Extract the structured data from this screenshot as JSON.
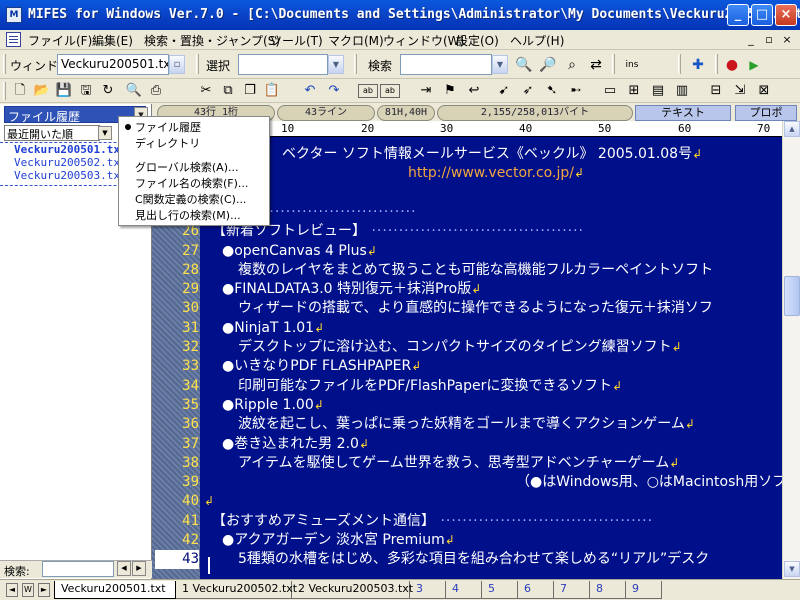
{
  "window": {
    "title": "MIFES for Windows Ver.7.0 - [C:\\Documents and Settings\\Administrator\\My Documents\\Veckuru200501.txt]",
    "icon_label": "M",
    "buttons": {
      "minimize": "_",
      "maximize": "□",
      "close": "×"
    }
  },
  "menu": {
    "items": [
      "ファイル(F)",
      "編集(E)",
      "検索・置換・ジャンプ(S)",
      "ツール(T)",
      "マクロ(M)",
      "ウィンドウ(W)",
      "設定(O)",
      "ヘルプ(H)"
    ],
    "mdi": [
      "_",
      "▫",
      "×"
    ]
  },
  "toolbar1": {
    "window_label": "ウィンドウ",
    "window_value": "Veckuru200501.txt",
    "select_label": "選択",
    "select_value": "",
    "search_label": "検索",
    "search_value": "",
    "icons": [
      "search-next-icon",
      "search-prev-icon",
      "search-all-icon",
      "replace-icon",
      "insert-icon",
      "add-icon",
      "record-icon",
      "play-icon"
    ]
  },
  "toolbar2": {
    "icons": [
      "new-file-icon",
      "open-icon",
      "save-icon",
      "save-all-icon",
      "refresh-icon",
      "preview-icon",
      "print-icon",
      "cut-icon",
      "copy-icon",
      "paste-icon",
      "undo-icon",
      "redo-icon",
      "abc-icon",
      "jump-icon",
      "tag-icon",
      "back-icon",
      "window1-icon",
      "window2-icon",
      "tile-icon",
      "cascade-icon",
      "split-icon",
      "exit-icon"
    ]
  },
  "status": {
    "line_col": "43行  1桁",
    "lines": "43ライン",
    "char_code": "81H,40H",
    "bytes": "2,155/258,013バイト",
    "mode_text": "テキスト",
    "mode_prop": "プロポ"
  },
  "ruler": {
    "marks": [
      "10",
      "20",
      "30",
      "40",
      "50",
      "60",
      "70"
    ]
  },
  "panel": {
    "combo": "ファイル履歴",
    "sort": "最近開いた順",
    "files": [
      "Veckuru200501.txt",
      "Veckuru200502.txt",
      "Veckuru200503.txt"
    ],
    "search_label": "検索:"
  },
  "popup": {
    "items": [
      "ファイル履歴",
      "ディレクトリ"
    ],
    "actions": [
      "グローバル検索(A)...",
      "ファイル名の検索(F)...",
      "C関数定義の検索(C)...",
      "見出し行の検索(M)..."
    ]
  },
  "editor": {
    "lines": [
      {
        "no": "",
        "text": "ベクター ソフト情報メールサービス《ベックル》 2005.01.08号",
        "eol": "↲",
        "kind": "header"
      },
      {
        "no": "",
        "text": "http://www.vector.co.jp/",
        "eol": "↲",
        "kind": "url"
      },
      {
        "no": "",
        "text": "",
        "eol": "",
        "kind": "blank"
      },
      {
        "no": "",
        "text": "",
        "eol": "",
        "kind": "rule"
      },
      {
        "no": "26",
        "text": "【新着ソフトレビュー】",
        "eol": "",
        "kind": "section"
      },
      {
        "no": "27",
        "text": "●openCanvas 4 Plus",
        "eol": "↲",
        "kind": "item"
      },
      {
        "no": "28",
        "text": "複数のレイヤをまとめて扱うことも可能な高機能フルカラーペイントソフト",
        "eol": "",
        "kind": "desc"
      },
      {
        "no": "29",
        "text": "●FINALDATA3.0 特別復元＋抹消Pro版",
        "eol": "↲",
        "kind": "item"
      },
      {
        "no": "30",
        "text": "ウィザードの搭載で、より直感的に操作できるようになった復元＋抹消ソフ",
        "eol": "",
        "kind": "desc"
      },
      {
        "no": "31",
        "text": "●NinjaT 1.01",
        "eol": "↲",
        "kind": "item"
      },
      {
        "no": "32",
        "text": "デスクトップに溶け込む、コンパクトサイズのタイピング練習ソフト",
        "eol": "↲",
        "kind": "desc"
      },
      {
        "no": "33",
        "text": "●いきなりPDF FLASHPAPER",
        "eol": "↲",
        "kind": "item"
      },
      {
        "no": "34",
        "text": "印刷可能なファイルをPDF/FlashPaperに変換できるソフト",
        "eol": "↲",
        "kind": "desc"
      },
      {
        "no": "35",
        "text": "●Ripple 1.00",
        "eol": "↲",
        "kind": "item"
      },
      {
        "no": "36",
        "text": "波紋を起こし、葉っぱに乗った妖精をゴールまで導くアクションゲーム",
        "eol": "↲",
        "kind": "desc"
      },
      {
        "no": "37",
        "text": "●巻き込まれた男 2.0",
        "eol": "↲",
        "kind": "item"
      },
      {
        "no": "38",
        "text": "アイテムを駆使してゲーム世界を救う、思考型アドベンチャーゲーム",
        "eol": "↲",
        "kind": "desc"
      },
      {
        "no": "39",
        "text": "（●はWindows用、○はMacintosh用ソフ",
        "eol": "",
        "kind": "note"
      },
      {
        "no": "40",
        "text": "",
        "eol": "↲",
        "kind": "empty"
      },
      {
        "no": "41",
        "text": "【おすすめアミューズメント通信】",
        "eol": "",
        "kind": "section"
      },
      {
        "no": "42",
        "text": "●アクアガーデン 淡水宮 Premium",
        "eol": "↲",
        "kind": "item"
      },
      {
        "no": "43",
        "text": "5種類の水槽をはじめ、多彩な項目を組み合わせて楽しめる“リアル”デスク",
        "eol": "",
        "kind": "desc"
      }
    ]
  },
  "tabs": {
    "items": [
      "Veckuru200501.txt",
      "1 Veckuru200502.txt",
      "2 Veckuru200503.txt",
      "3",
      "4",
      "5",
      "6",
      "7",
      "8",
      "9"
    ],
    "active_index": 0
  },
  "colors": {
    "editor_bg": "#000f8a",
    "line_no": "#ffe24a",
    "url": "#f1a640",
    "titlebar": "#0a58dd"
  }
}
